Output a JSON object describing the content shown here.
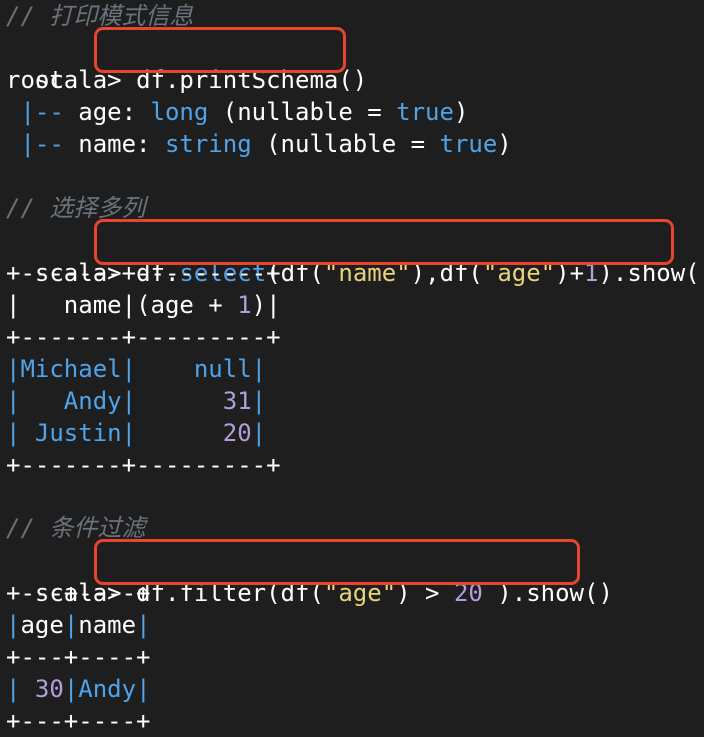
{
  "section1": {
    "comment": "// 打印模式信息",
    "prompt": "scala>",
    "command": "df.printSchema()",
    "root": "root",
    "fields": [
      {
        "prefix": " |-- ",
        "name": "age",
        "colon": ": ",
        "type": "long",
        "rest": " (nullable = ",
        "bool": "true",
        "close": ")"
      },
      {
        "prefix": " |-- ",
        "name": "name",
        "colon": ": ",
        "type": "string",
        "rest": " (nullable = ",
        "bool": "true",
        "close": ")"
      }
    ]
  },
  "section2": {
    "comment": "// 选择多列",
    "prompt": "scala>",
    "cmd": {
      "a": "df.",
      "b": "select",
      "c": "(df(",
      "d": "\"name\"",
      "e": "),df(",
      "f": "\"age\"",
      "g": ")+",
      "h": "1",
      "i": ").show()"
    },
    "border": "+-------+---------+",
    "header": {
      "p1": "|",
      "c1": "   name",
      "p2": "|",
      "c2a": "(age + ",
      "c2b": "1",
      "c2c": ")",
      "p3": "|"
    },
    "rows": [
      {
        "name": "Michael",
        "value": "    null"
      },
      {
        "name": "   Andy",
        "value": "      31"
      },
      {
        "name": " Justin",
        "value": "      20"
      }
    ]
  },
  "section3": {
    "comment": "// 条件过滤",
    "prompt": "scala>",
    "cmd": {
      "a": "df.filter(df(",
      "b": "\"age\"",
      "c": ") > ",
      "d": "20",
      "e": " ).show()"
    },
    "border": "+---+----+",
    "header": {
      "c1": "age",
      "c2": "name"
    },
    "rows": [
      {
        "age": " 30",
        "name": "Andy"
      }
    ]
  }
}
